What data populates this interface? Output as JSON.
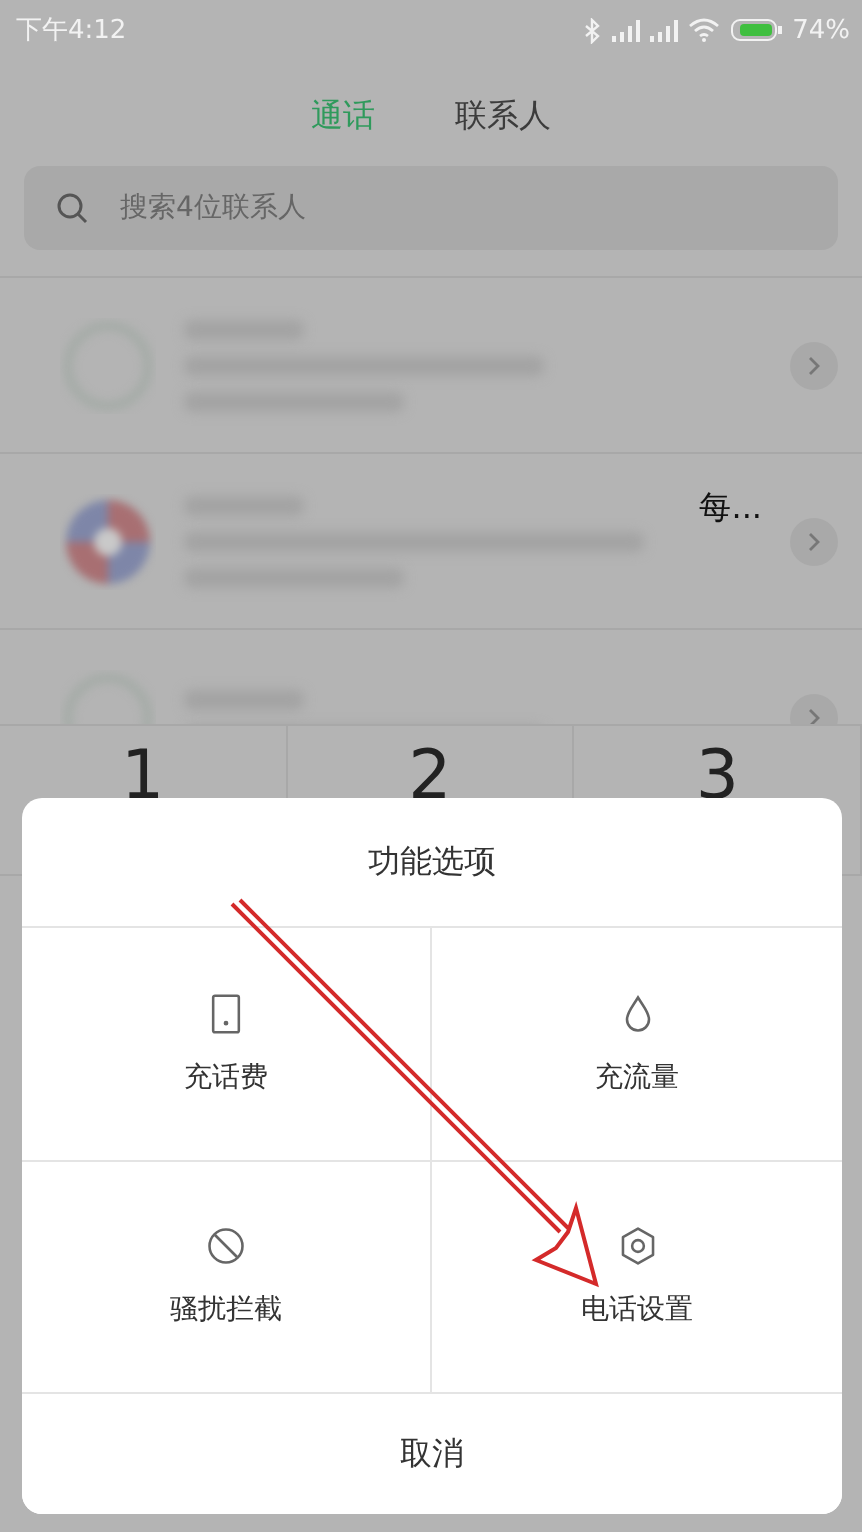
{
  "status_bar": {
    "time": "下午4:12",
    "battery": "74%"
  },
  "tabs": [
    {
      "label": "通话",
      "selected": true
    },
    {
      "label": "联系人",
      "selected": false
    }
  ],
  "search": {
    "placeholder": "搜索4位联系人"
  },
  "calls": [
    {
      "kind": "outline"
    },
    {
      "kind": "badge",
      "text": "每..."
    },
    {
      "kind": "outline"
    }
  ],
  "keypad": [
    "1",
    "2",
    "3"
  ],
  "dialog": {
    "title": "功能选项",
    "options": [
      {
        "label": "充话费",
        "kind": "phone"
      },
      {
        "label": "充流量",
        "kind": "drop"
      },
      {
        "label": "骚扰拦截",
        "kind": "block"
      },
      {
        "label": "电话设置",
        "kind": "gear"
      }
    ],
    "cancel": "取消"
  }
}
